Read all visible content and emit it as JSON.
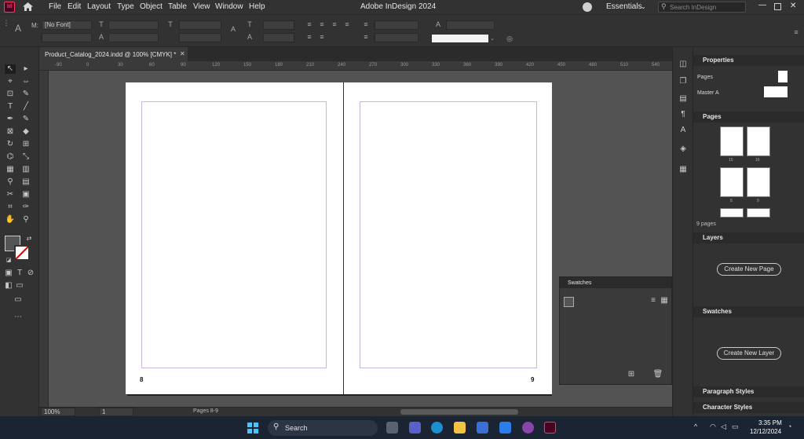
{
  "app": {
    "title": "Adobe InDesign 2024",
    "workspace": "Essentials",
    "search_placeholder": "Search InDesign",
    "logo": "Id"
  },
  "menu": [
    "File",
    "Edit",
    "Layout",
    "Type",
    "Object",
    "Table",
    "View",
    "Window",
    "Help"
  ],
  "control": {
    "font": "[No Font]",
    "font_label": "M:"
  },
  "document": {
    "tab": "Product_Catalog_2024.indd @ 100% [CMYK] *",
    "page_left_num": "8",
    "page_right_num": "9"
  },
  "ruler": {
    "h_labels": [
      "-90",
      "0",
      "30",
      "60",
      "90",
      "120",
      "150",
      "180",
      "210",
      "240",
      "270",
      "300",
      "330",
      "360",
      "390",
      "420",
      "450",
      "480",
      "510",
      "540"
    ]
  },
  "status": {
    "zoom": "100%",
    "page": "1",
    "pages_label": "Pages 8-9"
  },
  "panels": {
    "properties": "Properties",
    "pages_row": "Pages",
    "master_row": "Master A",
    "pages": "Pages",
    "thumb_labels": [
      "15",
      "16",
      "8",
      "9"
    ],
    "pages_count": "9 pages",
    "layers": "Layers",
    "create_page_btn": "Create New Page",
    "swatches": "Swatches",
    "create_layer_btn": "Create New Layer",
    "paragraph_styles": "Paragraph Styles",
    "character_styles": "Character Styles",
    "swatches_float": "Swatches"
  },
  "taskbar": {
    "search": "Search",
    "time": "3:35 PM",
    "date": "12/12/2024"
  },
  "colors": {
    "accent": "#49021f",
    "id_pink": "#ff3366",
    "win_blue": "#0078d4"
  }
}
